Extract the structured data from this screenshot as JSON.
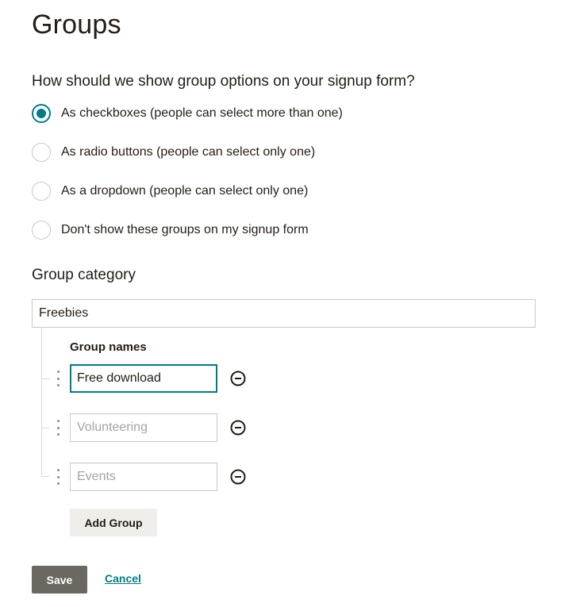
{
  "page": {
    "title": "Groups"
  },
  "display_options": {
    "question": "How should we show group options on your signup form?",
    "options": [
      {
        "label": "As checkboxes (people can select more than one)",
        "selected": true
      },
      {
        "label": "As radio buttons (people can select only one)",
        "selected": false
      },
      {
        "label": "As a dropdown (people can select only one)",
        "selected": false
      },
      {
        "label": "Don't show these groups on my signup form",
        "selected": false
      }
    ]
  },
  "category": {
    "heading": "Group category",
    "value": "Freebies"
  },
  "group_names": {
    "label": "Group names",
    "items": [
      {
        "value": "Free download",
        "placeholder": ""
      },
      {
        "value": "",
        "placeholder": "Volunteering"
      },
      {
        "value": "",
        "placeholder": "Events"
      }
    ],
    "add_label": "Add Group"
  },
  "actions": {
    "save_label": "Save",
    "cancel_label": "Cancel"
  },
  "colors": {
    "accent": "#007c89",
    "save_bg": "#6b6761",
    "secondary_bg": "#efeeea"
  }
}
